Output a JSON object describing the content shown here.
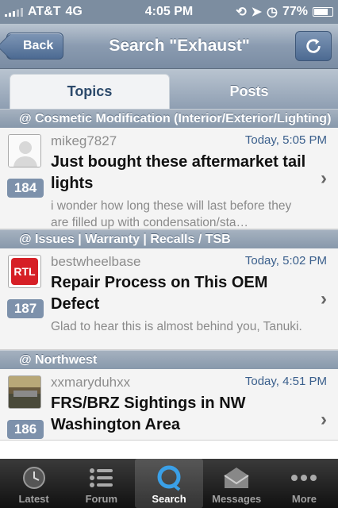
{
  "status_bar": {
    "carrier": "AT&T",
    "network": "4G",
    "time": "4:05 PM",
    "battery": "77%"
  },
  "nav": {
    "back_label": "Back",
    "title": "Search \"Exhaust\""
  },
  "segments": {
    "topics": "Topics",
    "posts": "Posts"
  },
  "sections": [
    {
      "title": "@ Cosmetic Modification (Interior/Exterior/Lighting)",
      "item": {
        "user": "mikeg7827",
        "time": "Today, 5:05 PM",
        "title": "Just bought these aftermarket tail lights",
        "snippet": "i wonder how long these will last before they are filled up with condensation/sta…",
        "count": "184"
      }
    },
    {
      "title": "@ Issues | Warranty | Recalls / TSB",
      "item": {
        "user": "bestwheelbase",
        "time": "Today, 5:02 PM",
        "title": "Repair Process on This OEM Defect",
        "snippet": "Glad to hear this is almost behind you, Tanuki.",
        "count": "187",
        "logo_text": "RTL"
      }
    },
    {
      "title": "@ Northwest",
      "item": {
        "user": "xxmaryduhxx",
        "time": "Today, 4:51 PM",
        "title": "FRS/BRZ Sightings in NW Washington Area",
        "snippet": "",
        "count": "186"
      }
    }
  ],
  "tabbar": [
    {
      "label": "Latest",
      "icon": "clock-icon"
    },
    {
      "label": "Forum",
      "icon": "list-icon"
    },
    {
      "label": "Search",
      "icon": "search-icon",
      "active": true
    },
    {
      "label": "Messages",
      "icon": "envelope-icon"
    },
    {
      "label": "More",
      "icon": "more-icon"
    }
  ]
}
